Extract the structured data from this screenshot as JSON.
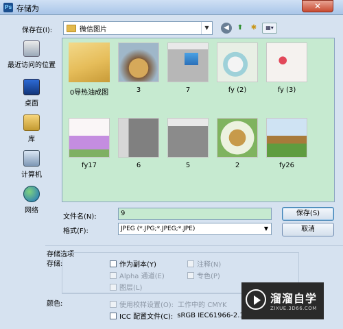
{
  "window": {
    "title": "存储为",
    "app_icon": "Ps",
    "close_label": "✕"
  },
  "save_in": {
    "label": "保存在(I):",
    "value": "微信图片"
  },
  "toolbar_icons": [
    "back-icon",
    "up-folder-icon",
    "new-folder-icon",
    "view-menu-icon"
  ],
  "places": [
    {
      "label": "最近访问的位置",
      "icon": "recent-places-icon"
    },
    {
      "label": "桌面",
      "icon": "desktop-icon"
    },
    {
      "label": "库",
      "icon": "library-icon"
    },
    {
      "label": "计算机",
      "icon": "computer-icon"
    },
    {
      "label": "网络",
      "icon": "network-icon"
    }
  ],
  "files": [
    {
      "name": "0导热油成图",
      "kind": "folder"
    },
    {
      "name": "3",
      "kind": "image"
    },
    {
      "name": "7",
      "kind": "image"
    },
    {
      "name": "fy (2)",
      "kind": "image"
    },
    {
      "name": "fy (3)",
      "kind": "image"
    },
    {
      "name": "fy17",
      "kind": "image"
    },
    {
      "name": "6",
      "kind": "image"
    },
    {
      "name": "5",
      "kind": "image"
    },
    {
      "name": "2",
      "kind": "image"
    },
    {
      "name": "fy26",
      "kind": "image"
    }
  ],
  "filename": {
    "label": "文件名(N):",
    "value": "9"
  },
  "format": {
    "label": "格式(F):",
    "value": "JPEG (*.JPG;*.JPEG;*.JPE)"
  },
  "buttons": {
    "save": "保存(S)",
    "cancel": "取消"
  },
  "options": {
    "title": "存储选项",
    "storage_label": "存储:",
    "color_label": "颜色:",
    "as_copy": "作为副本(Y)",
    "notes": "注释(N)",
    "alpha": "Alpha 通道(E)",
    "spot": "专色(P)",
    "layers": "图层(L)",
    "proof": "使用校样设置(O):",
    "proof_value": "工作中的 CMYK",
    "icc": "ICC 配置文件(C):",
    "icc_value": "sRGB IEC61966-2.1"
  },
  "watermark": {
    "brand": "溜溜自学",
    "url": "ZIXUE.3D66.COM"
  }
}
